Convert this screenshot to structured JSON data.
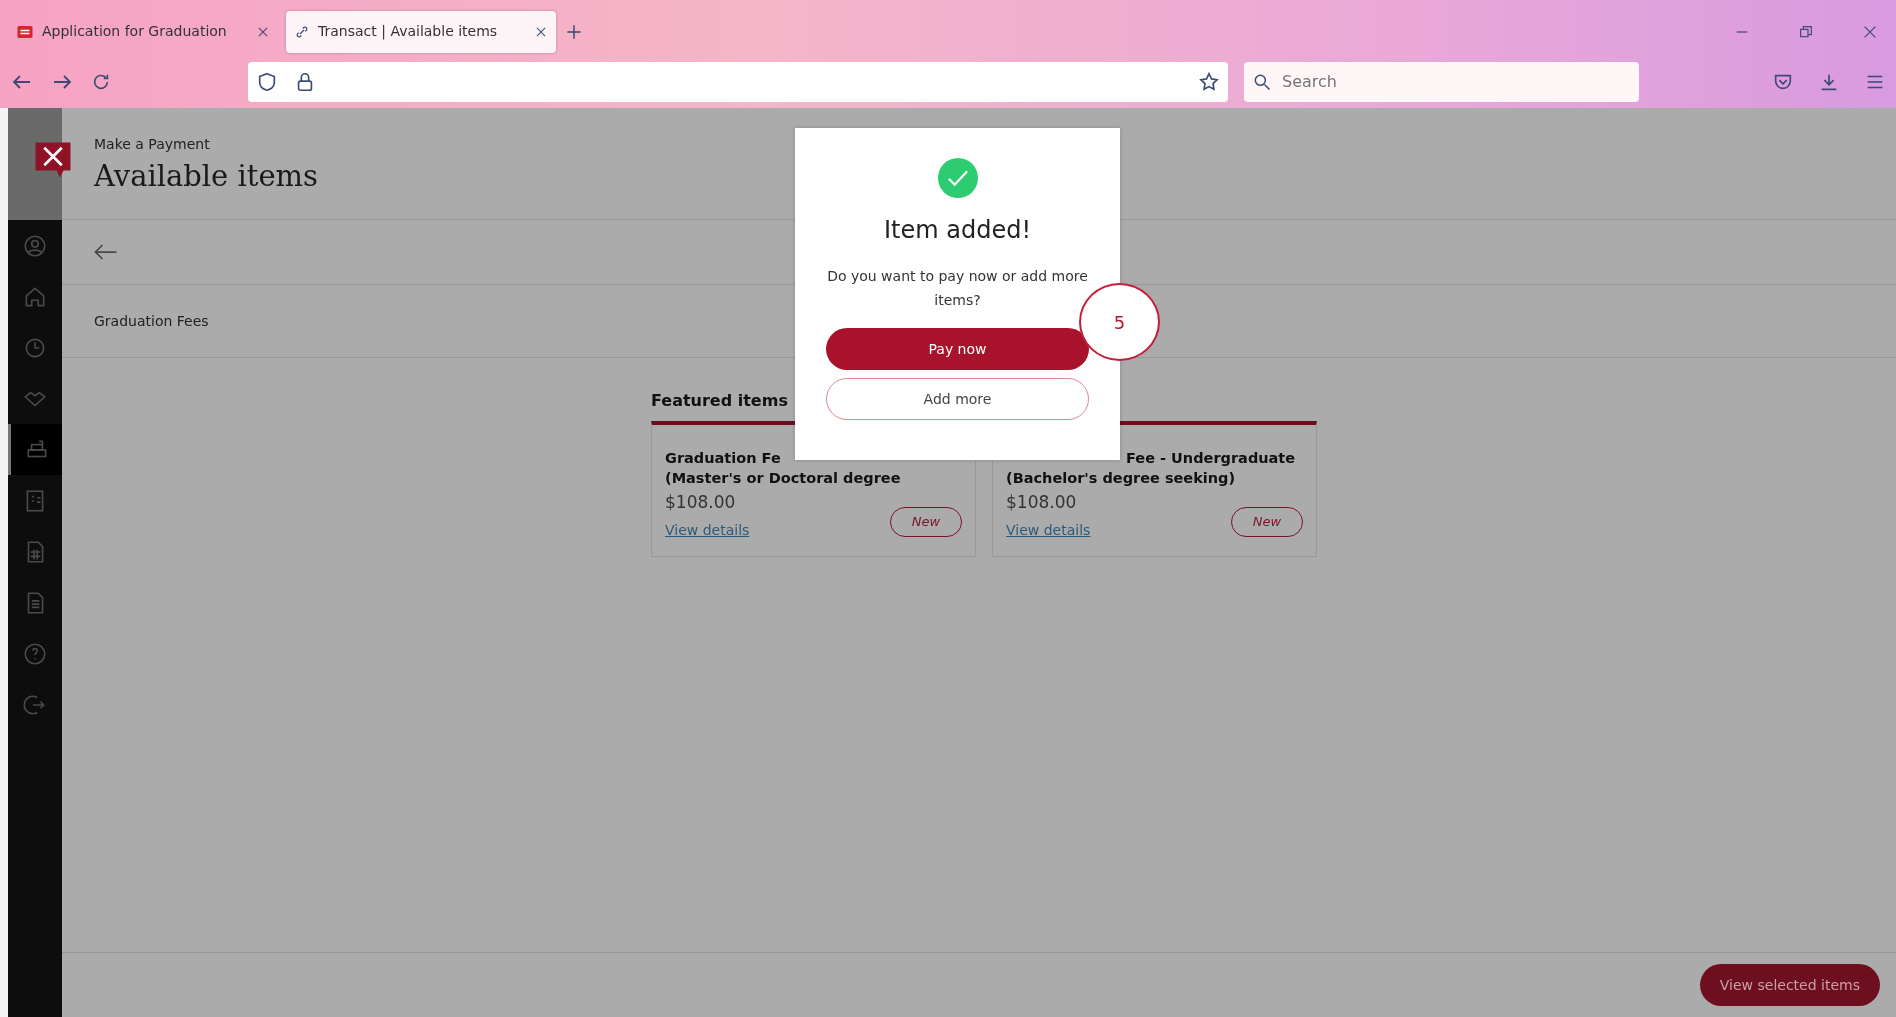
{
  "browser": {
    "tabs": [
      {
        "label": "Application for Graduation",
        "selected": false
      },
      {
        "label": "Transact | Available items",
        "selected": true
      }
    ],
    "search": {
      "placeholder": "Search"
    }
  },
  "sidebar": {
    "items": [
      {
        "selected": false
      },
      {
        "selected": false
      },
      {
        "selected": false
      },
      {
        "selected": false
      },
      {
        "selected": true
      },
      {
        "selected": false
      },
      {
        "selected": false
      },
      {
        "selected": false
      },
      {
        "selected": false
      },
      {
        "selected": false
      }
    ]
  },
  "header": {
    "breadcrumb": "Make a Payment",
    "title": "Available items"
  },
  "category": "Graduation Fees",
  "featured": {
    "heading": "Featured items",
    "cards": [
      {
        "title_lines": [
          "Graduation Fe",
          "(Master's or Doctoral degree"
        ],
        "price": "$108.00",
        "link": "View details",
        "badge": "New"
      },
      {
        "title_lines": [
          "Fee - Undergraduate",
          "(Bachelor's degree seeking)"
        ],
        "price": "$108.00",
        "link": "View details",
        "badge": "New"
      }
    ]
  },
  "dialog": {
    "title": "Item added!",
    "message": "Do you want to pay now or add more items?",
    "buttons": [
      {
        "label": "Pay now",
        "kind": "primary"
      },
      {
        "label": "Add more",
        "kind": "outline"
      }
    ]
  },
  "annotation": "5",
  "footer": {
    "button": "View selected items"
  }
}
